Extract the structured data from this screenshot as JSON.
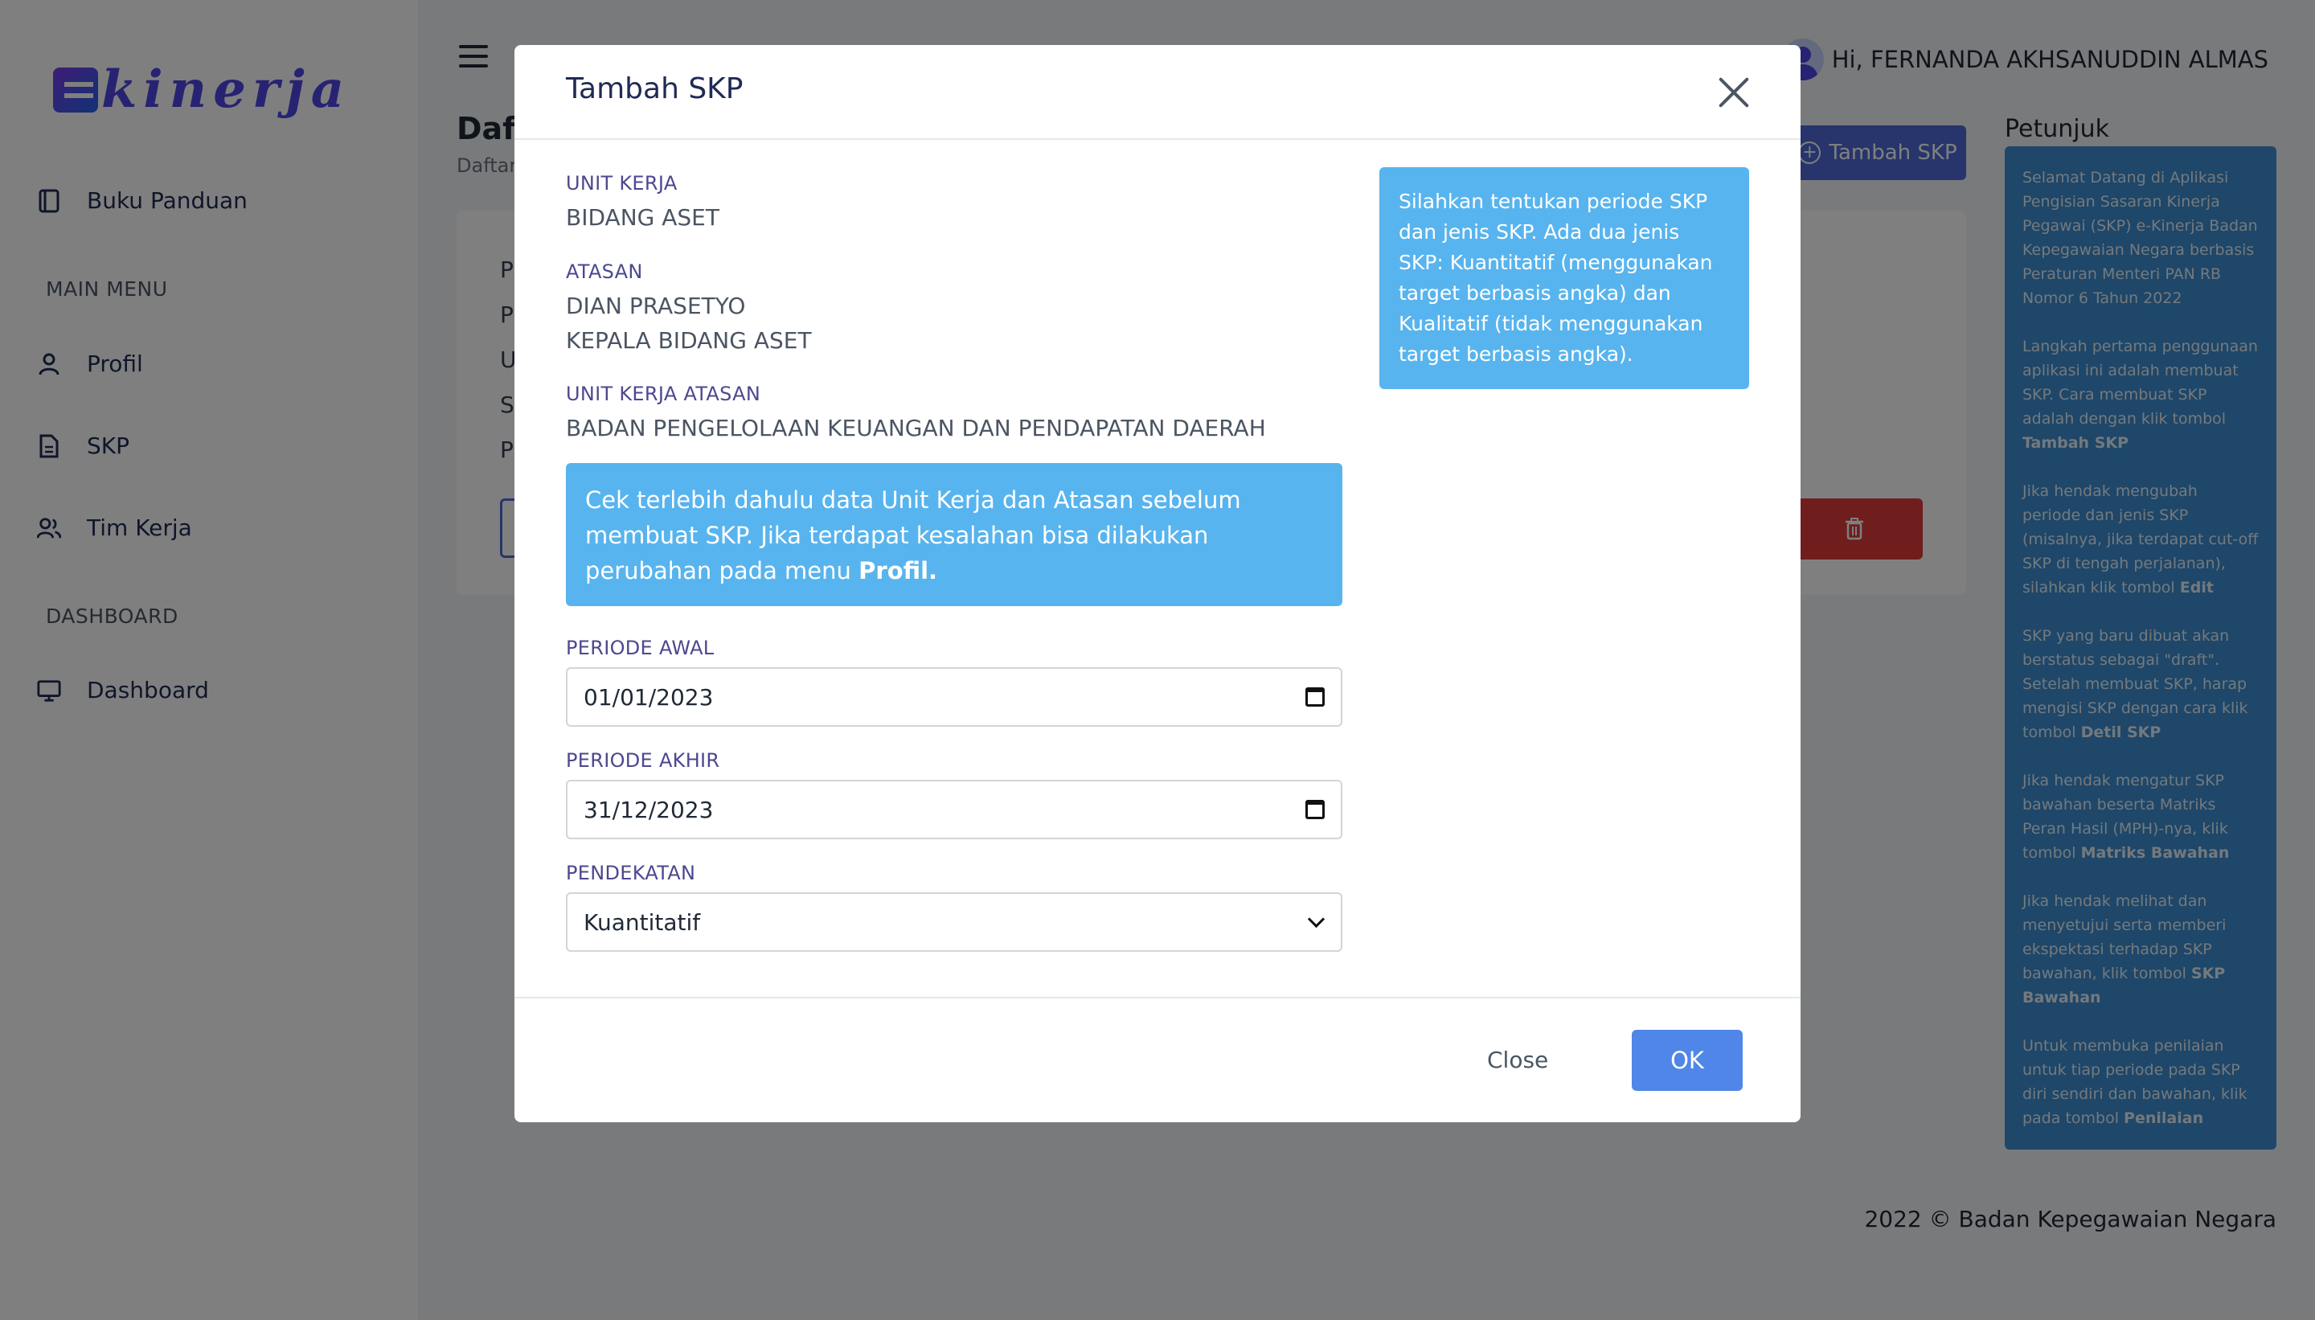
{
  "app": {
    "logo_text": "kinerja"
  },
  "sidebar": {
    "items": [
      {
        "label": "Buku Panduan",
        "icon": "book-icon"
      },
      {
        "label": "Profil",
        "icon": "user-icon"
      },
      {
        "label": "SKP",
        "icon": "document-icon"
      },
      {
        "label": "Tim Kerja",
        "icon": "users-icon"
      },
      {
        "label": "Dashboard",
        "icon": "monitor-icon"
      }
    ],
    "sections": [
      "MAIN MENU",
      "DASHBOARD"
    ]
  },
  "header": {
    "greeting": "Hi, FERNANDA AKHSANUDDIN ALMAS"
  },
  "main": {
    "title_partial": "Daft",
    "subtitle_partial": "Daftar",
    "add_button_label": "Tambah SKP",
    "card_letters": [
      "P",
      "P",
      "U",
      "S",
      "P"
    ]
  },
  "petunjuk": {
    "title": "Petunjuk",
    "paragraphs": [
      {
        "text": "Selamat Datang di Aplikasi Pengisian Sasaran Kinerja Pegawai (SKP) e-Kinerja Badan Kepegawaian Negara berbasis Peraturan Menteri PAN RB Nomor 6 Tahun 2022",
        "bold": ""
      },
      {
        "text": "Langkah pertama penggunaan aplikasi ini adalah membuat SKP. Cara membuat SKP adalah dengan klik tombol ",
        "bold": "Tambah SKP"
      },
      {
        "text": "Jika hendak mengubah periode dan jenis SKP (misalnya, jika terdapat cut-off SKP di tengah perjalanan), silahkan klik tombol ",
        "bold": "Edit"
      },
      {
        "text": "SKP yang baru dibuat akan berstatus sebagai \"draft\". Setelah membuat SKP, harap mengisi SKP dengan cara klik tombol ",
        "bold": "Detil SKP"
      },
      {
        "text": "Jika hendak mengatur SKP bawahan beserta Matriks Peran Hasil (MPH)-nya, klik tombol ",
        "bold": "Matriks Bawahan"
      },
      {
        "text": "Jika hendak melihat dan menyetujui serta memberi ekspektasi terhadap SKP bawahan, klik tombol ",
        "bold": "SKP Bawahan"
      },
      {
        "text": "Untuk membuka penilaian untuk tiap periode pada SKP diri sendiri dan bawahan, klik pada tombol ",
        "bold": "Penilaian"
      }
    ]
  },
  "footer": {
    "text": "2022 © Badan Kepegawaian Negara"
  },
  "modal": {
    "title": "Tambah SKP",
    "unit_kerja_label": "UNIT KERJA",
    "unit_kerja_value": "BIDANG ASET",
    "atasan_label": "ATASAN",
    "atasan_name": "DIAN PRASETYO",
    "atasan_position": "KEPALA BIDANG ASET",
    "unit_kerja_atasan_label": "UNIT KERJA ATASAN",
    "unit_kerja_atasan_value": "BADAN PENGELOLAAN KEUANGAN DAN PENDAPATAN DAERAH",
    "info_left": "Cek terlebih dahulu data Unit Kerja dan Atasan sebelum membuat SKP. Jika terdapat kesalahan bisa dilakukan perubahan pada menu ",
    "info_left_bold": "Profil.",
    "info_right": "Silahkan tentukan periode SKP dan jenis SKP. Ada dua jenis SKP: Kuantitatif (menggunakan target berbasis angka) dan Kualitatif (tidak menggunakan target berbasis angka).",
    "periode_awal_label": "PERIODE AWAL",
    "periode_awal_value": "01/01/2023",
    "periode_akhir_label": "PERIODE AKHIR",
    "periode_akhir_value": "31/12/2023",
    "pendekatan_label": "PENDEKATAN",
    "pendekatan_value": "Kuantitatif",
    "close_label": "Close",
    "ok_label": "OK"
  },
  "colors": {
    "primary": "#4f6bd8",
    "info": "#58b4ee",
    "petunjuk_bg": "#3c8fd3",
    "danger": "#e03b3b",
    "ok_button": "#4f86e8"
  }
}
